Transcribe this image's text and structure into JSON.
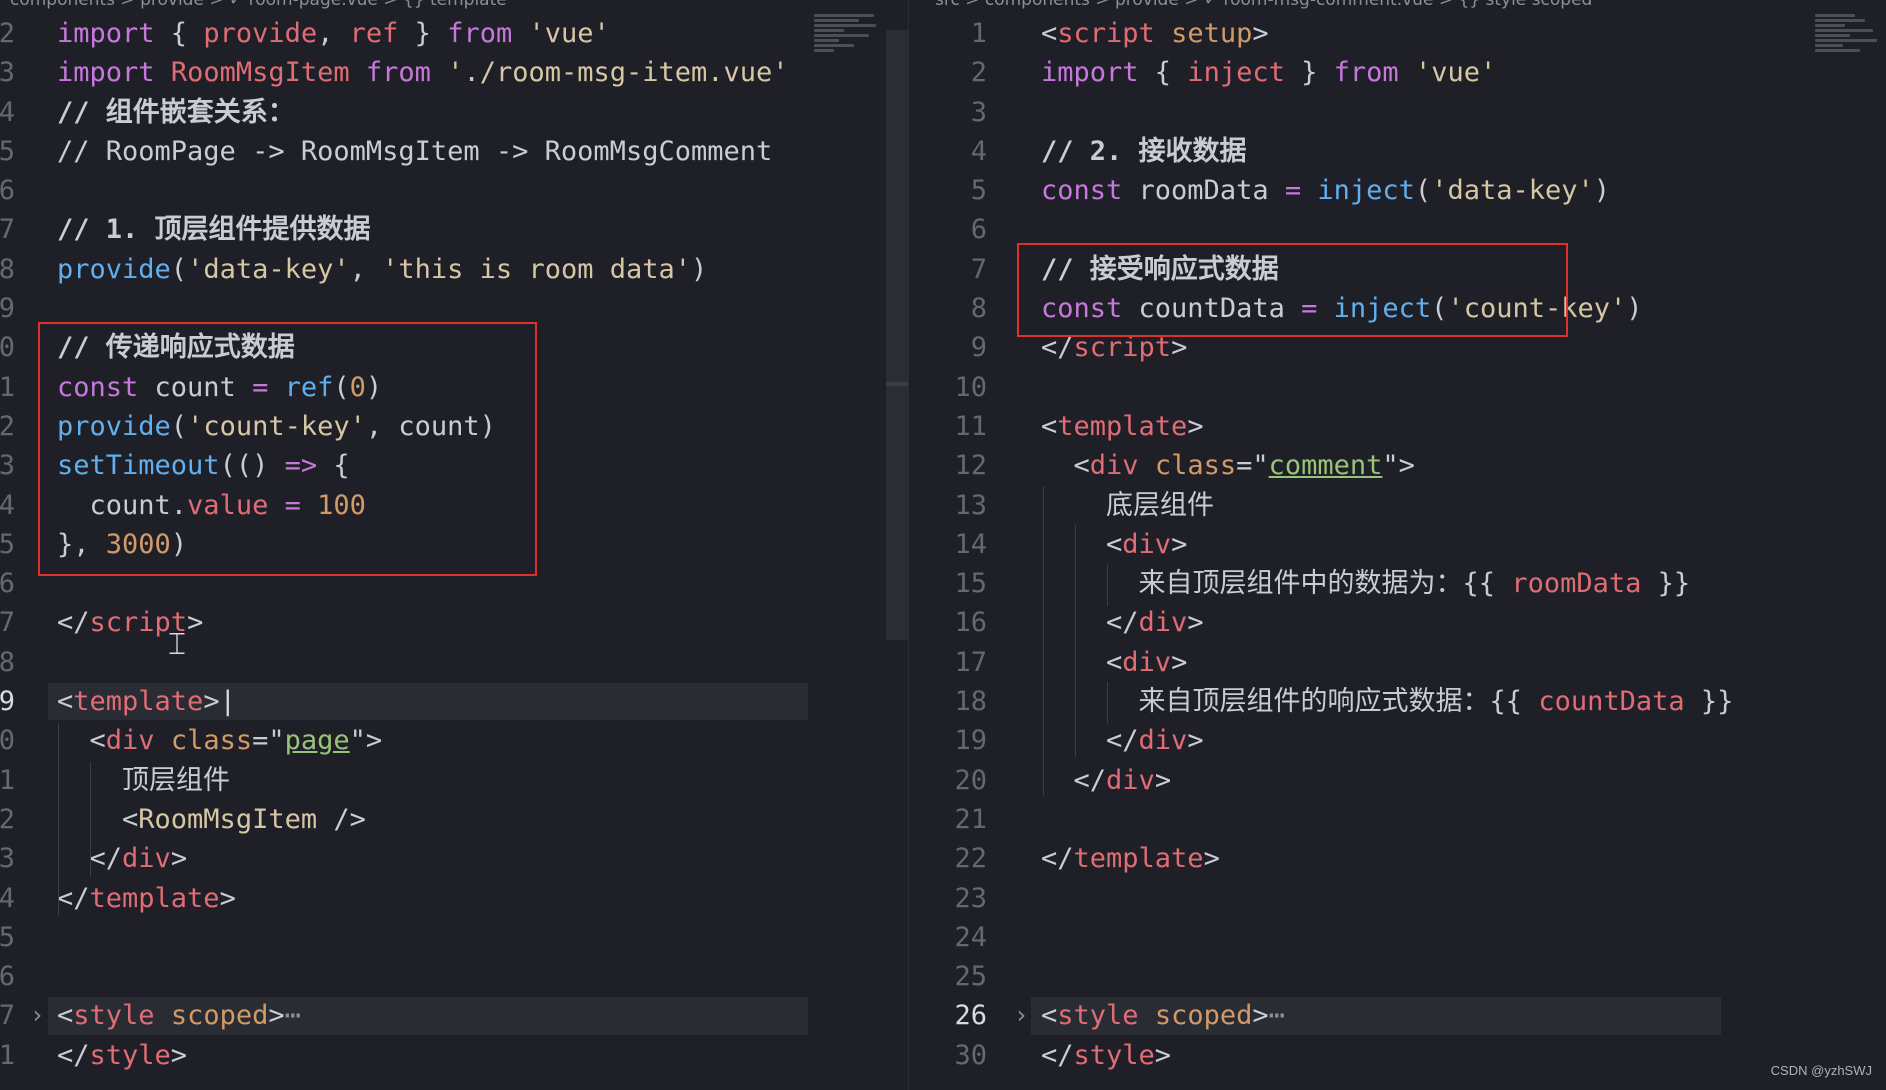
{
  "left_pane": {
    "breadcrumb": "components > provide > ✓ room-page.vue > {} template",
    "lines": [
      {
        "num": "2",
        "parts": [
          [
            "k",
            "import"
          ],
          [
            "p",
            " { "
          ],
          [
            "ref",
            "provide"
          ],
          [
            "p",
            ", "
          ],
          [
            "ref",
            "ref"
          ],
          [
            "p",
            " } "
          ],
          [
            "k",
            "from"
          ],
          [
            "p",
            " "
          ],
          [
            "s",
            "'vue'"
          ]
        ]
      },
      {
        "num": "3",
        "parts": [
          [
            "k",
            "import"
          ],
          [
            "p",
            " "
          ],
          [
            "ref",
            "RoomMsgItem"
          ],
          [
            "p",
            " "
          ],
          [
            "k",
            "from"
          ],
          [
            "p",
            " "
          ],
          [
            "s",
            "'./room-msg-item.vue'"
          ]
        ]
      },
      {
        "num": "4",
        "parts": [
          [
            "c",
            "// 组件嵌套关系："
          ]
        ]
      },
      {
        "num": "5",
        "parts": [
          [
            "cm",
            "// RoomPage -> RoomMsgItem -> RoomMsgComment"
          ]
        ]
      },
      {
        "num": "6",
        "parts": []
      },
      {
        "num": "7",
        "parts": [
          [
            "c",
            "// 1. 顶层组件提供数据"
          ]
        ]
      },
      {
        "num": "8",
        "parts": [
          [
            "fn",
            "provide"
          ],
          [
            "p",
            "("
          ],
          [
            "s",
            "'data-key'"
          ],
          [
            "p",
            ", "
          ],
          [
            "s",
            "'this is room data'"
          ],
          [
            "p",
            ")"
          ]
        ]
      },
      {
        "num": "9",
        "parts": []
      },
      {
        "num": "0",
        "parts": [
          [
            "c",
            "// 传递响应式数据"
          ]
        ]
      },
      {
        "num": "1",
        "parts": [
          [
            "k",
            "const"
          ],
          [
            "p",
            " count "
          ],
          [
            "k",
            "="
          ],
          [
            "p",
            " "
          ],
          [
            "fn",
            "ref"
          ],
          [
            "p",
            "("
          ],
          [
            "num",
            "0"
          ],
          [
            "p",
            ")"
          ]
        ]
      },
      {
        "num": "2",
        "parts": [
          [
            "fn",
            "provide"
          ],
          [
            "p",
            "("
          ],
          [
            "s",
            "'count-key'"
          ],
          [
            "p",
            ", count)"
          ]
        ]
      },
      {
        "num": "3",
        "parts": [
          [
            "fn",
            "setTimeout"
          ],
          [
            "p",
            "(() "
          ],
          [
            "k",
            "=>"
          ],
          [
            "p",
            " {"
          ]
        ]
      },
      {
        "num": "4",
        "parts": [
          [
            "p",
            "  count."
          ],
          [
            "ref",
            "value"
          ],
          [
            "p",
            " "
          ],
          [
            "k",
            "="
          ],
          [
            "p",
            " "
          ],
          [
            "num",
            "100"
          ]
        ]
      },
      {
        "num": "5",
        "parts": [
          [
            "p",
            "}, "
          ],
          [
            "num",
            "3000"
          ],
          [
            "p",
            ")"
          ]
        ]
      },
      {
        "num": "6",
        "parts": []
      },
      {
        "num": "7",
        "parts": [
          [
            "p",
            "</"
          ],
          [
            "t",
            "script"
          ],
          [
            "p",
            ">"
          ]
        ]
      },
      {
        "num": "8",
        "parts": []
      },
      {
        "num": "9",
        "active": true,
        "hl": true,
        "parts": [
          [
            "p",
            "<"
          ],
          [
            "t",
            "template"
          ],
          [
            "p",
            ">"
          ],
          [
            "mark",
            "|"
          ]
        ]
      },
      {
        "num": "0",
        "parts": [
          [
            "p",
            "  <"
          ],
          [
            "t",
            "div"
          ],
          [
            "p",
            " "
          ],
          [
            "attr",
            "class"
          ],
          [
            "p",
            "=\""
          ],
          [
            "u",
            "page"
          ],
          [
            "p",
            "\">"
          ]
        ]
      },
      {
        "num": "1",
        "parts": [
          [
            "g",
            "    顶层组件"
          ]
        ]
      },
      {
        "num": "2",
        "parts": [
          [
            "p",
            "    <"
          ],
          [
            "s",
            "RoomMsgItem"
          ],
          [
            "p",
            " />"
          ]
        ]
      },
      {
        "num": "3",
        "parts": [
          [
            "p",
            "  </"
          ],
          [
            "t",
            "div"
          ],
          [
            "p",
            ">"
          ]
        ]
      },
      {
        "num": "4",
        "parts": [
          [
            "p",
            "</"
          ],
          [
            "t",
            "template"
          ],
          [
            "p",
            ">"
          ]
        ]
      },
      {
        "num": "5",
        "parts": []
      },
      {
        "num": "6",
        "parts": []
      },
      {
        "num": "7",
        "fold": true,
        "hl": true,
        "parts": [
          [
            "p",
            "<"
          ],
          [
            "t",
            "style"
          ],
          [
            "p",
            " "
          ],
          [
            "attr",
            "scoped"
          ],
          [
            "p",
            ">"
          ],
          [
            "dots",
            "⋯"
          ]
        ]
      },
      {
        "num": "1",
        "parts": [
          [
            "p",
            "</"
          ],
          [
            "t",
            "style"
          ],
          [
            "p",
            ">"
          ]
        ]
      }
    ]
  },
  "right_pane": {
    "breadcrumb": "src > components > provide > ✓ room-msg-comment.vue > {} style scoped",
    "lines": [
      {
        "num": "1",
        "parts": [
          [
            "p",
            "<"
          ],
          [
            "t",
            "script"
          ],
          [
            "p",
            " "
          ],
          [
            "attr",
            "setup"
          ],
          [
            "p",
            ">"
          ]
        ]
      },
      {
        "num": "2",
        "parts": [
          [
            "k",
            "import"
          ],
          [
            "p",
            " { "
          ],
          [
            "ref",
            "inject"
          ],
          [
            "p",
            " } "
          ],
          [
            "k",
            "from"
          ],
          [
            "p",
            " "
          ],
          [
            "s",
            "'vue'"
          ]
        ]
      },
      {
        "num": "3",
        "parts": []
      },
      {
        "num": "4",
        "parts": [
          [
            "c",
            "// 2. 接收数据"
          ]
        ]
      },
      {
        "num": "5",
        "parts": [
          [
            "k",
            "const"
          ],
          [
            "p",
            " roomData "
          ],
          [
            "k",
            "="
          ],
          [
            "p",
            " "
          ],
          [
            "fn",
            "inject"
          ],
          [
            "p",
            "("
          ],
          [
            "s",
            "'data-key'"
          ],
          [
            "p",
            ")"
          ]
        ]
      },
      {
        "num": "6",
        "parts": []
      },
      {
        "num": "7",
        "parts": [
          [
            "c",
            "// 接受响应式数据"
          ]
        ]
      },
      {
        "num": "8",
        "parts": [
          [
            "k",
            "const"
          ],
          [
            "p",
            " countData "
          ],
          [
            "k",
            "="
          ],
          [
            "p",
            " "
          ],
          [
            "fn",
            "inject"
          ],
          [
            "p",
            "("
          ],
          [
            "s",
            "'count-key'"
          ],
          [
            "p",
            ")"
          ]
        ]
      },
      {
        "num": "9",
        "parts": [
          [
            "p",
            "</"
          ],
          [
            "t",
            "script"
          ],
          [
            "p",
            ">"
          ]
        ]
      },
      {
        "num": "10",
        "parts": []
      },
      {
        "num": "11",
        "parts": [
          [
            "p",
            "<"
          ],
          [
            "t",
            "template"
          ],
          [
            "p",
            ">"
          ]
        ]
      },
      {
        "num": "12",
        "parts": [
          [
            "p",
            "  <"
          ],
          [
            "t",
            "div"
          ],
          [
            "p",
            " "
          ],
          [
            "attr",
            "class"
          ],
          [
            "p",
            "=\""
          ],
          [
            "u",
            "comment"
          ],
          [
            "p",
            "\">"
          ]
        ]
      },
      {
        "num": "13",
        "parts": [
          [
            "g",
            "    底层组件"
          ]
        ]
      },
      {
        "num": "14",
        "parts": [
          [
            "p",
            "    <"
          ],
          [
            "t",
            "div"
          ],
          [
            "p",
            ">"
          ]
        ]
      },
      {
        "num": "15",
        "parts": [
          [
            "g",
            "      来自顶层组件中的数据为：{{ "
          ],
          [
            "ref",
            "roomData"
          ],
          [
            "g",
            " }}"
          ]
        ]
      },
      {
        "num": "16",
        "parts": [
          [
            "p",
            "    </"
          ],
          [
            "t",
            "div"
          ],
          [
            "p",
            ">"
          ]
        ]
      },
      {
        "num": "17",
        "parts": [
          [
            "p",
            "    <"
          ],
          [
            "t",
            "div"
          ],
          [
            "p",
            ">"
          ]
        ]
      },
      {
        "num": "18",
        "parts": [
          [
            "g",
            "      来自顶层组件的响应式数据：{{ "
          ],
          [
            "ref",
            "countData"
          ],
          [
            "g",
            " }}"
          ]
        ]
      },
      {
        "num": "19",
        "parts": [
          [
            "p",
            "    </"
          ],
          [
            "t",
            "div"
          ],
          [
            "p",
            ">"
          ]
        ]
      },
      {
        "num": "20",
        "parts": [
          [
            "p",
            "  </"
          ],
          [
            "t",
            "div"
          ],
          [
            "p",
            ">"
          ]
        ]
      },
      {
        "num": "21",
        "parts": []
      },
      {
        "num": "22",
        "parts": [
          [
            "p",
            "</"
          ],
          [
            "t",
            "template"
          ],
          [
            "p",
            ">"
          ]
        ]
      },
      {
        "num": "23",
        "parts": []
      },
      {
        "num": "24",
        "parts": []
      },
      {
        "num": "25",
        "parts": []
      },
      {
        "num": "26",
        "active": true,
        "fold": true,
        "hl": true,
        "parts": [
          [
            "p",
            "<"
          ],
          [
            "t",
            "style"
          ],
          [
            "p",
            " "
          ],
          [
            "attr",
            "scoped"
          ],
          [
            "p",
            ">"
          ],
          [
            "dots",
            "⋯"
          ]
        ]
      },
      {
        "num": "30",
        "parts": [
          [
            "p",
            "</"
          ],
          [
            "t",
            "style"
          ],
          [
            "p",
            ">"
          ]
        ]
      }
    ]
  },
  "icons": {
    "fold": "chevron-right-icon",
    "cursor": "text-cursor-icon"
  },
  "cursor_glyph": "⌶",
  "watermark": "CSDN @yzhSWJ",
  "colors": {
    "highlight_box": "#e0302a",
    "background": "#1f2027"
  }
}
